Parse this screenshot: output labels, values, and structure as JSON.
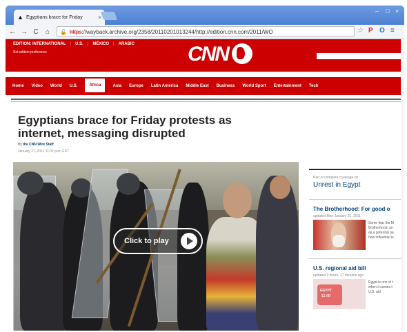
{
  "browser": {
    "tab_title": "Egyptians brace for Friday",
    "tab_close": "×",
    "tab_favicon": "▲",
    "window_controls": [
      "–",
      "□",
      "×"
    ],
    "nav_buttons": [
      "←",
      "→",
      "C",
      "⌂"
    ],
    "url_scheme": "https",
    "url_rest": "://wayback.archive.org/2358/20110201013244/http://edition.cnn.com/2011/WO",
    "extensions": [
      "☆",
      "P",
      "O",
      "≡"
    ]
  },
  "cnn": {
    "editions": [
      "EDITION: INTERNATIONAL",
      "U.S.",
      "MÉXICO",
      "ARABIC"
    ],
    "set_pref": "Set edition preference",
    "logo": "CNN",
    "nav": [
      "Home",
      "Video",
      "World",
      "U.S.",
      "Africa",
      "Asia",
      "Europe",
      "Latin America",
      "Middle East",
      "Business",
      "World Sport",
      "Entertainment",
      "Tech"
    ],
    "active_nav": "Africa"
  },
  "article": {
    "headline": "Egyptians brace for Friday protests as internet, messaging disrupted",
    "byline_prefix": "By ",
    "byline_author": "the CNN Wire Staff",
    "dateline": "January 27, 2011 11:07 p.m. EST",
    "play_label": "Click to play"
  },
  "sidebar": {
    "part_of": "Part of complete coverage on",
    "unrest": "Unrest in Egypt",
    "story1": {
      "title": "The Brotherhood: For good o",
      "updated": "updated Mon January 31, 2011",
      "text": [
        "Some fear the M",
        "Brotherhood, an",
        "as a potential pa",
        "how influential is"
      ]
    },
    "story2": {
      "title": "U.S. regional aid bill",
      "updated": "updated 3 hours, 17 minutes ago",
      "text": [
        "Egypt is one of t",
        "when it comes t",
        "U.S. aid"
      ],
      "map_label1": "EGYPT",
      "map_label2": "$1.6B"
    }
  },
  "colors": {
    "cnn_red": "#cc0000",
    "link_blue": "#004276",
    "browser_blue": "#4d86d8"
  }
}
